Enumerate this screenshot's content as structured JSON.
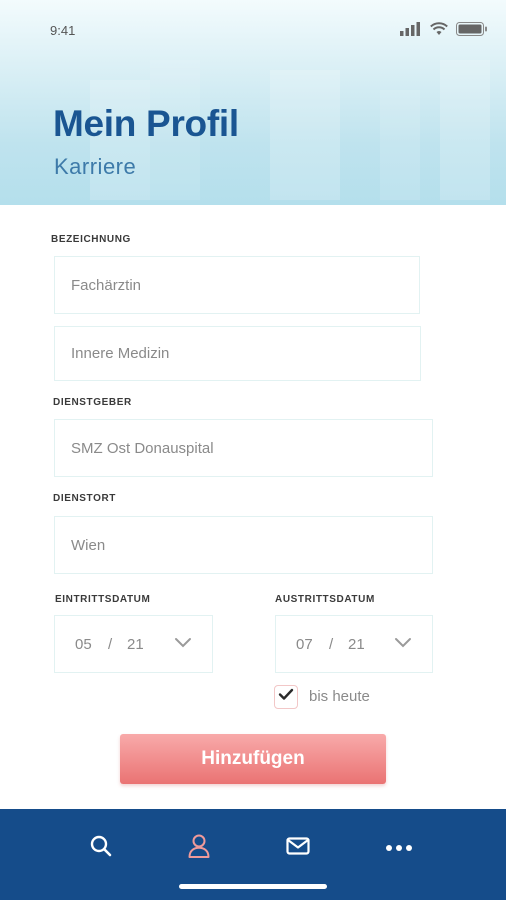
{
  "status_bar": {
    "time": "9:41"
  },
  "header": {
    "title": "Mein Profil",
    "subtitle": "Karriere"
  },
  "form": {
    "bezeichnung_label": "BEZEICHNUNG",
    "bezeichnung_value": "Fachärztin",
    "fachrichtung_value": "Innere Medizin",
    "dienstgeber_label": "DIENSTGEBER",
    "dienstgeber_value": "SMZ Ost Donauspital",
    "dienstort_label": "DIENSTORT",
    "dienstort_value": "Wien",
    "eintritt": {
      "label": "EINTRITTSDATUM",
      "month": "05",
      "separator": "/",
      "year": "21"
    },
    "austritt": {
      "label": "AUSTRITTSDATUM",
      "month": "07",
      "separator": "/",
      "year": "21"
    },
    "bis_heute_label": "bis heute",
    "bis_heute_checked": true,
    "submit_label": "Hinzufügen"
  },
  "tabbar": {
    "items": [
      "search-icon",
      "profile-icon",
      "mail-icon",
      "more-icon"
    ],
    "active": "profile-icon"
  },
  "colors": {
    "primary": "#1a5592",
    "tabbar": "#154c8a",
    "accent": "#ea7373",
    "active_tab": "#f09a9a"
  }
}
